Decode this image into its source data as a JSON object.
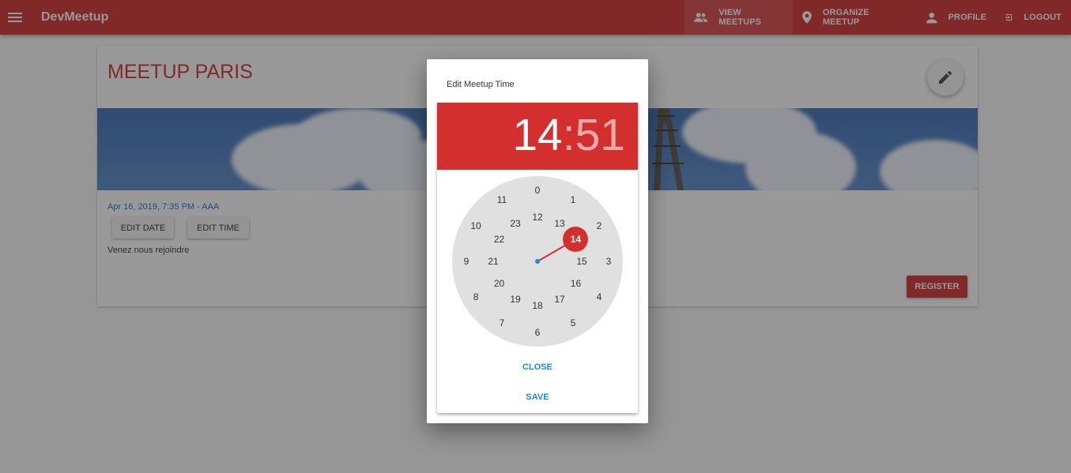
{
  "app": {
    "title": "DevMeetup"
  },
  "nav": [
    {
      "label": "View Meetups",
      "icon": "people-icon",
      "active": true
    },
    {
      "label": "Organize Meetup",
      "icon": "location-pin-icon",
      "active": false
    },
    {
      "label": "Profile",
      "icon": "person-icon",
      "active": false
    },
    {
      "label": "Logout",
      "icon": "logout-icon",
      "active": false
    }
  ],
  "meetup": {
    "title": "MEETUP PARIS",
    "datetime": "Apr 16, 2019, 7:35 PM - AAA",
    "edit_date_label": "EDIT DATE",
    "edit_time_label": "EDIT TIME",
    "description": "Venez nous rejoindre",
    "register_label": "REGISTER"
  },
  "dialog": {
    "title": "Edit Meetup Time",
    "time": {
      "hours": "14",
      "separator": ":",
      "minutes": "51"
    },
    "clock": {
      "outer": [
        "0",
        "1",
        "2",
        "3",
        "4",
        "5",
        "6",
        "7",
        "8",
        "9",
        "10",
        "11"
      ],
      "inner": [
        "12",
        "13",
        "14",
        "15",
        "16",
        "17",
        "18",
        "19",
        "20",
        "21",
        "22",
        "23"
      ],
      "selected_hour": 14
    },
    "close_label": "CLOSE",
    "save_label": "SAVE"
  },
  "colors": {
    "primary": "#d32f2f",
    "accent": "#1e88e5",
    "link": "#1976d2"
  }
}
